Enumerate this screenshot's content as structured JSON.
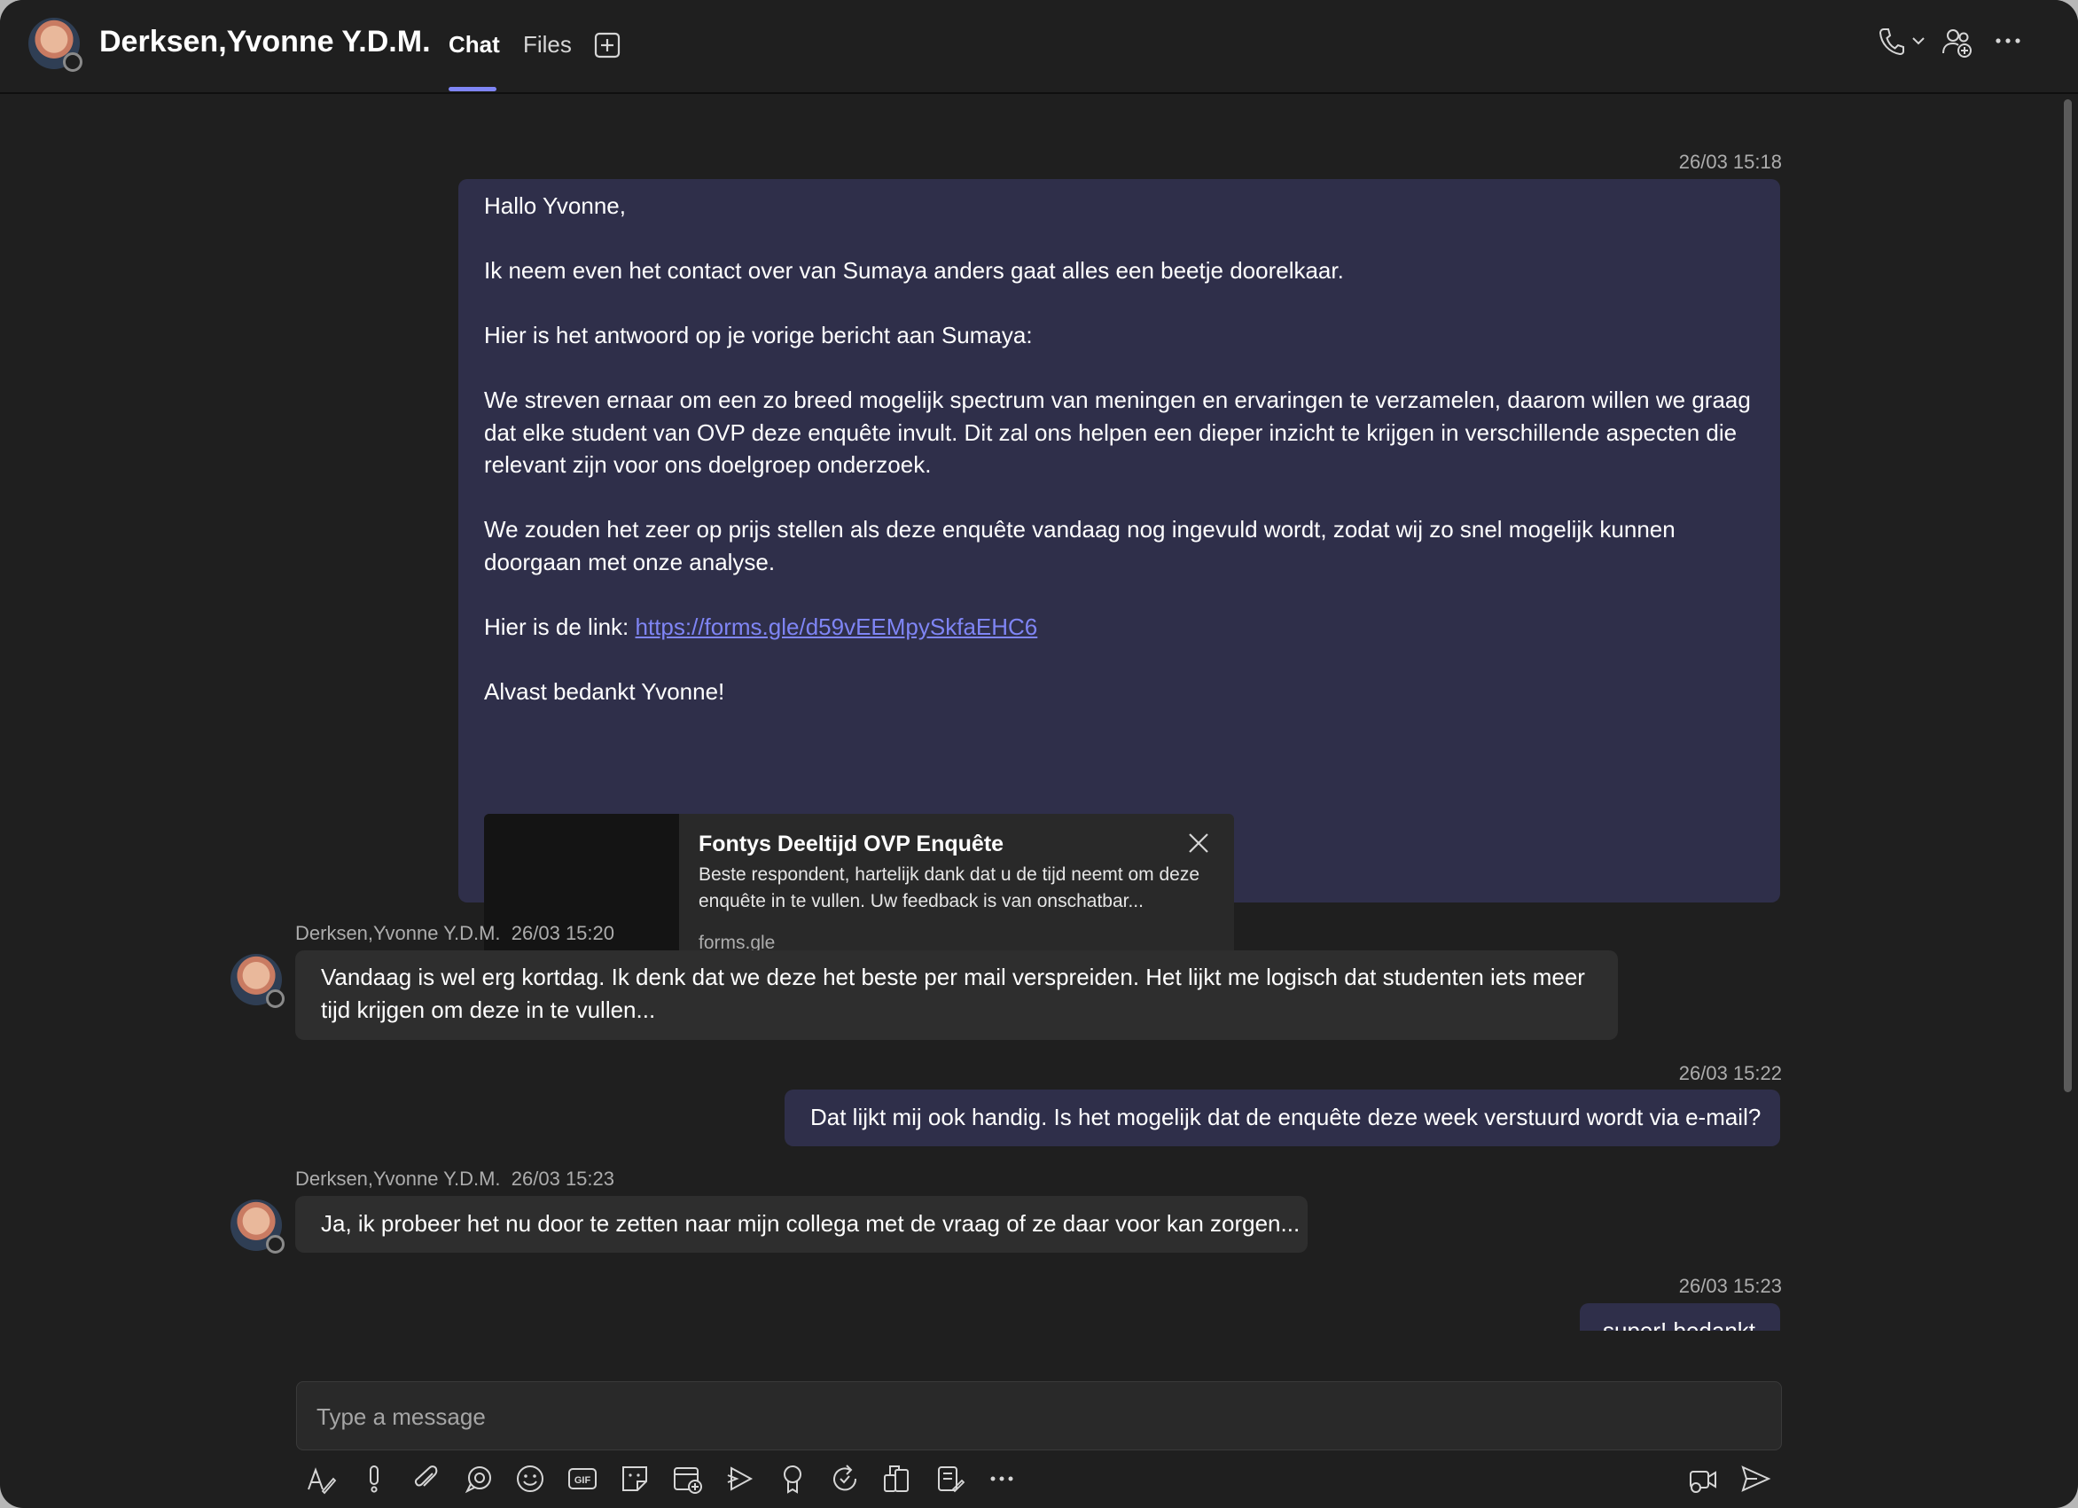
{
  "header": {
    "contact_name": "Derksen,Yvonne Y.D.M.",
    "tabs": [
      {
        "label": "Chat",
        "active": true
      },
      {
        "label": "Files",
        "active": false
      }
    ],
    "icons": [
      "add-tab-icon",
      "call-icon",
      "chevron-down-icon",
      "add-people-icon",
      "more-options-icon"
    ]
  },
  "messages": {
    "m1": {
      "timestamp": "26/03 15:18",
      "lines": {
        "l1": "Hallo Yvonne,",
        "l2": "Ik neem even het contact over van Sumaya anders gaat alles een beetje doorelkaar.",
        "l3": "Hier is het antwoord op je vorige bericht aan Sumaya:",
        "l4": "We streven ernaar om een zo breed mogelijk spectrum van meningen en ervaringen te verzamelen, daarom willen we graag dat elke student van OVP deze enquête invult. Dit zal ons helpen een dieper inzicht te krijgen in verschillende aspecten die relevant zijn voor ons doelgroep onderzoek.",
        "l5": "We zouden het zeer op prijs stellen als deze enquête vandaag nog ingevuld wordt, zodat wij zo snel mogelijk kunnen doorgaan met onze analyse.",
        "l6_prefix": "Hier is de link:",
        "l6_link": "https://forms.gle/d59vEEMpySkfaEHC6",
        "l7": "Alvast bedankt Yvonne!"
      },
      "link_card": {
        "title": "Fontys Deeltijd OVP Enquête",
        "description": "Beste respondent, hartelijk dank dat u de tijd neemt om deze enquête in te vullen. Uw feedback is van onschatbar...",
        "domain": "forms.gle"
      }
    },
    "m2": {
      "sender": "Derksen,Yvonne Y.D.M.",
      "timestamp": "26/03 15:20",
      "text": "Vandaag is wel erg kortdag. Ik denk dat we deze het beste per mail verspreiden. Het lijkt me logisch dat studenten iets meer tijd krijgen om deze in te vullen..."
    },
    "m3": {
      "timestamp": "26/03 15:22",
      "text": "Dat lijkt mij ook handig. Is het mogelijk dat de enquête deze week verstuurd wordt via e-mail?"
    },
    "m4": {
      "sender": "Derksen,Yvonne Y.D.M.",
      "timestamp": "26/03 15:23",
      "text": "Ja, ik probeer het nu door te zetten naar mijn collega met de vraag of ze daar voor kan zorgen..."
    },
    "m5": {
      "timestamp": "26/03 15:23",
      "text": "super! bedankt"
    }
  },
  "compose": {
    "placeholder": "Type a message",
    "toolbar_icons": [
      "format-icon",
      "important-icon",
      "attach-icon",
      "loop-icon",
      "emoji-icon",
      "gif-icon",
      "sticker-icon",
      "schedule-meeting-icon",
      "stream-icon",
      "praise-icon",
      "updates-icon",
      "apps-icon",
      "forms-icon",
      "more-icon",
      "meet-now-icon",
      "send-icon"
    ]
  },
  "colors": {
    "background": "#1f1f1f",
    "my_bubble": "#2f2f4a",
    "their_bubble": "#2e2e2e",
    "accent": "#7f85f5"
  }
}
